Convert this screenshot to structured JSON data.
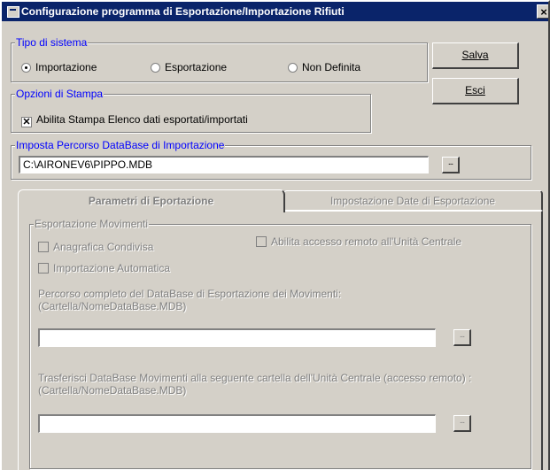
{
  "window": {
    "title": "Configurazione programma di Esportazione/Importazione Rifiuti",
    "close_glyph": "×"
  },
  "tipo_sistema": {
    "legend": "Tipo di sistema",
    "options": [
      {
        "label": "Importazione",
        "selected": true
      },
      {
        "label": "Esportazione",
        "selected": false
      },
      {
        "label": "Non Definita",
        "selected": false
      }
    ]
  },
  "buttons": {
    "salva_label": "Salva",
    "esci_label": "Esci"
  },
  "opzioni_stampa": {
    "legend": "Opzioni di Stampa",
    "checkbox_label": "Abilita Stampa Elenco dati esportati/importati",
    "checked": true,
    "check_glyph": "✕"
  },
  "percorso_importazione": {
    "legend": "Imposta Percorso DataBase di Importazione",
    "value": "C:\\AIRONEV6\\PIPPO.MDB",
    "browse_label": "..."
  },
  "tabs": [
    {
      "label": "Parametri di Eportazione",
      "active": true
    },
    {
      "label": "Impostazione Date di Esportazione",
      "active": false
    }
  ],
  "esportazione_movimenti": {
    "legend": "Esportazione Movimenti",
    "anagrafica_label": "Anagrafica Condivisa",
    "importazione_auto_label": "Importazione Automatica",
    "accesso_remoto_label": "Abilita accesso remoto all'Unità Centrale",
    "percorso_label_1": "Percorso completo del DataBase di Esportazione dei Movimenti:",
    "percorso_label_2": "(Cartella/NomeDataBase.MDB)",
    "percorso_value": "",
    "trasferisci_label_1": "Trasferisci DataBase Movimenti alla seguente cartella dell'Unità Centrale (accesso remoto) :",
    "trasferisci_label_2": "(Cartella/NomeDataBase.MDB)",
    "trasferisci_value": "",
    "browse_label": "..."
  }
}
